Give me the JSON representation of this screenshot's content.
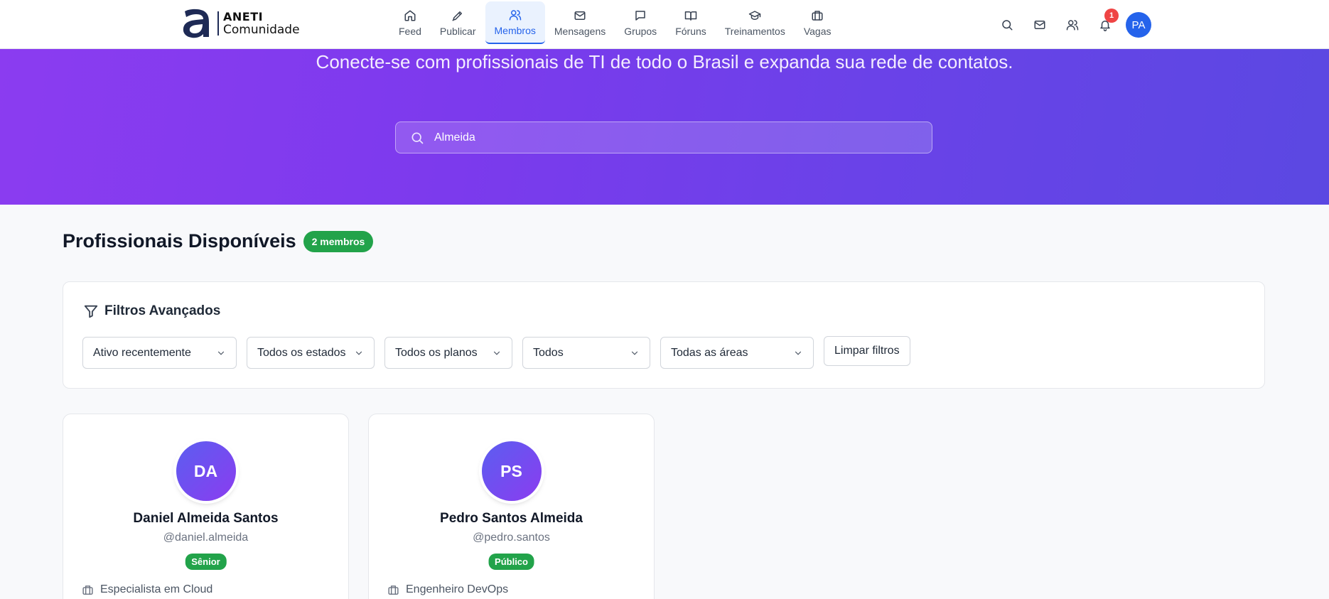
{
  "app": {
    "logo_top": "ANETI",
    "logo_bottom": "Comunidade"
  },
  "nav": {
    "items": [
      {
        "label": "Feed",
        "icon": "home-icon"
      },
      {
        "label": "Publicar",
        "icon": "pen-icon"
      },
      {
        "label": "Membros",
        "icon": "users-icon",
        "active": true
      },
      {
        "label": "Mensagens",
        "icon": "mail-icon"
      },
      {
        "label": "Grupos",
        "icon": "chat-icon"
      },
      {
        "label": "Fóruns",
        "icon": "book-icon"
      },
      {
        "label": "Treinamentos",
        "icon": "graduation-cap-icon"
      },
      {
        "label": "Vagas",
        "icon": "briefcase-icon"
      }
    ],
    "notifications_count": "1",
    "user_initials": "PA"
  },
  "hero": {
    "subtitle": "Conecte-se com profissionais de TI de todo o Brasil e expanda sua rede de contatos.",
    "search_value": "Almeida"
  },
  "section": {
    "title": "Profissionais Disponíveis",
    "count_badge": "2 membros"
  },
  "filters": {
    "title": "Filtros Avançados",
    "selects": [
      "Ativo recentemente",
      "Todos os estados",
      "Todos os planos",
      "Todos",
      "Todas as áreas"
    ],
    "clear_label": "Limpar filtros"
  },
  "members": [
    {
      "initials": "DA",
      "name": "Daniel Almeida Santos",
      "handle": "@daniel.almeida",
      "level": "Sênior",
      "role": "Especialista em Cloud"
    },
    {
      "initials": "PS",
      "name": "Pedro Santos Almeida",
      "handle": "@pedro.santos",
      "level": "Público",
      "role": "Engenheiro DevOps"
    }
  ],
  "colors": {
    "accent": "#2563eb",
    "hero_gradient_start": "#8b3cf0",
    "hero_gradient_end": "#5b48e2",
    "badge_green": "#22a34a",
    "notification_red": "#ef4444"
  }
}
